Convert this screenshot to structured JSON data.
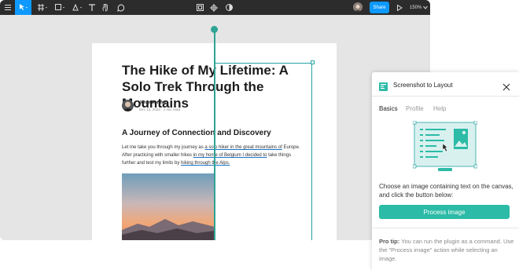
{
  "toolbar": {
    "icons": [
      "menu-icon",
      "move-tool-icon",
      "frame-tool-icon",
      "pen-tool-icon",
      "text-tool-icon",
      "hand-tool-icon",
      "comment-tool-icon",
      "component-icon",
      "plugin-icon",
      "theme-icon",
      "play-icon"
    ],
    "share_label": "Share",
    "zoom_label": "150%"
  },
  "article": {
    "title": "The Hike of My Lifetime: A Solo Trek Through the Mountains",
    "author": "Johan Ronsse",
    "meta": "Dec 13, 2023 · 1 min read",
    "heading": "A Journey of Connection and Discovery",
    "body_1": "Let me take you through my journey as ",
    "body_link_1": "a solo hiker in the great mountains of",
    "body_2": " Europe. After practicing with smaller hikes ",
    "body_link_2": "in my home of Belgium I decided to",
    "body_3": " take things further and test my limits by ",
    "body_link_3": "hiking through the Alps."
  },
  "plugin": {
    "title": "Screenshot to Layout",
    "tabs": [
      "Basics",
      "Profile",
      "Help"
    ],
    "active_tab": "Basics",
    "description": "Choose an image containing text on the canvas, and click the button below:",
    "button_label": "Process image",
    "tip_label": "Pro tip:",
    "tip_text": " You can run the plugin as a command. Use the \"Process image\" action while selecting an image.",
    "accent_color": "#2bbba6"
  }
}
